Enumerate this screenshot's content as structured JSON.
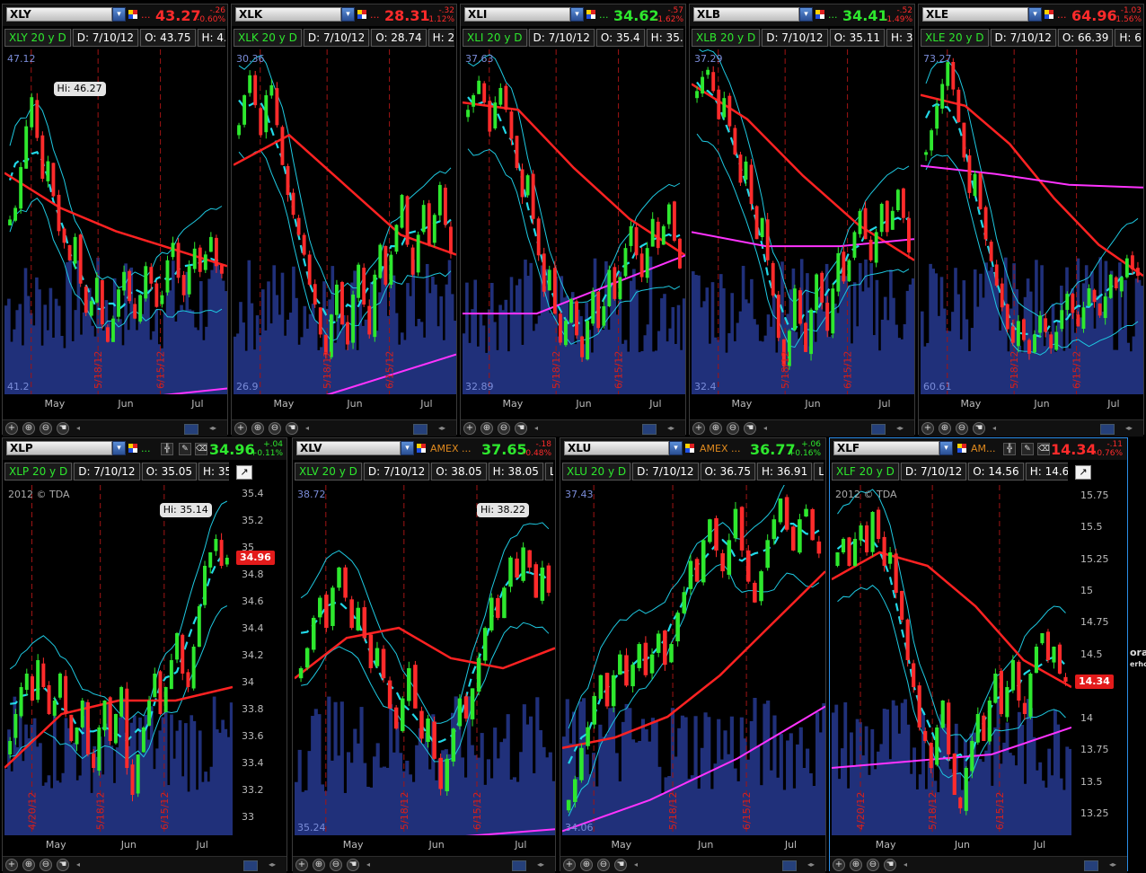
{
  "app": {
    "side_text": [
      "ora",
      "erhc"
    ]
  },
  "colors": {
    "up": "#2ee82e",
    "down": "#ff2b2b",
    "ma50": "#ff2222",
    "ma20": "#22d8e8",
    "ma200": "#ff33ff",
    "bands": "#1ec8e0",
    "volume": "#20307a"
  },
  "icons": {
    "header": [
      "dropdown-icon",
      "link-flag-icon",
      "crosshair-icon",
      "pencil-icon",
      "eraser-icon"
    ],
    "footer": [
      "crosshair-icon",
      "zoom-in-icon",
      "zoom-out-icon",
      "drag-hand-icon",
      "scroll-left-icon",
      "scroll-right-icon",
      "expand-icon"
    ]
  },
  "panes": [
    {
      "symbol": "XLY",
      "exchange": "...",
      "last": "43.27",
      "change": "-.26",
      "change_pct": "-0.60%",
      "dir": "dn",
      "study_label": "XLY 20 y D",
      "date_label": "D: 7/10/12",
      "open_label": "O: 43.75",
      "extra_label": "H: 4...",
      "axis_top": "47.12",
      "axis_bottom": "41.2",
      "hi_label": "Hi: 46.27",
      "months": [
        "May",
        "Jun",
        "Jul"
      ],
      "date_marks": [
        "5/18/12",
        "6/15/12"
      ],
      "chart_data": {
        "type": "candlestick",
        "closes": [
          44.2,
          44.4,
          45.1,
          45.8,
          46.3,
          45.6,
          44.9,
          45.2,
          44.6,
          44.0,
          43.8,
          43.5,
          43.9,
          43.1,
          42.6,
          42.8,
          43.2,
          42.4,
          42.1,
          42.5,
          43.0,
          43.3,
          42.8,
          42.5,
          42.9,
          43.4,
          43.1,
          42.7,
          42.9,
          43.5,
          43.8,
          43.2,
          42.9,
          43.4,
          43.7,
          43.3,
          43.6,
          43.9,
          43.4,
          43.27
        ],
        "ylim": [
          41.2,
          47.12
        ],
        "ma50": [
          45.0,
          44.4,
          44.0,
          43.7,
          43.4
        ],
        "ma200": [
          40.9,
          41.3
        ]
      }
    },
    {
      "symbol": "XLK",
      "exchange": "...",
      "last": "28.31",
      "change": "-.32",
      "change_pct": "-1.12%",
      "dir": "dn",
      "study_label": "XLK 20 y D",
      "date_label": "D: 7/10/12",
      "open_label": "O: 28.74",
      "extra_label": "H: 2...",
      "axis_top": "30.36",
      "axis_bottom": "26.9",
      "months": [
        "May",
        "Jun",
        "Jul"
      ],
      "date_marks": [
        "5/18/12",
        "6/15/12"
      ],
      "chart_data": {
        "type": "candlestick",
        "closes": [
          29.6,
          29.9,
          30.1,
          29.8,
          29.5,
          29.9,
          30.0,
          29.6,
          29.2,
          28.9,
          28.7,
          28.5,
          28.3,
          28.0,
          27.8,
          27.5,
          27.3,
          27.7,
          28.0,
          27.6,
          27.4,
          27.9,
          28.2,
          27.8,
          27.5,
          28.1,
          28.4,
          28.0,
          28.3,
          28.6,
          28.9,
          28.4,
          28.1,
          28.5,
          28.8,
          28.4,
          28.7,
          29.0,
          28.6,
          28.31
        ],
        "ylim": [
          26.9,
          30.36
        ],
        "ma50": [
          29.2,
          29.5,
          29.0,
          28.5,
          28.3
        ],
        "ma200": [
          26.6,
          27.3
        ]
      }
    },
    {
      "symbol": "XLI",
      "exchange": "...",
      "last": "34.62",
      "change": "-.57",
      "change_pct": "-1.62%",
      "dir": "up",
      "study_label": "XLI 20 y D",
      "date_label": "D: 7/10/12",
      "open_label": "O: 35.4",
      "extra_label": "H: 35...",
      "axis_top": "37.63",
      "axis_bottom": "32.89",
      "months": [
        "May",
        "Jun",
        "Jul"
      ],
      "date_marks": [
        "5/18/12",
        "6/15/12"
      ],
      "chart_data": {
        "type": "candlestick",
        "closes": [
          36.8,
          37.0,
          37.2,
          36.9,
          36.5,
          36.9,
          37.1,
          36.8,
          36.4,
          36.0,
          35.6,
          35.9,
          35.3,
          34.8,
          34.3,
          34.6,
          34.0,
          33.6,
          33.9,
          34.2,
          33.7,
          33.4,
          33.9,
          34.3,
          33.8,
          34.1,
          34.6,
          34.2,
          34.5,
          34.9,
          35.2,
          34.8,
          34.5,
          34.9,
          35.3,
          34.9,
          35.2,
          35.5,
          35.0,
          34.62
        ],
        "ylim": [
          32.89,
          37.63
        ],
        "ma50": [
          36.9,
          36.8,
          36.0,
          35.3,
          34.8
        ],
        "ma200": [
          34.0,
          34.0,
          34.4,
          34.8
        ]
      }
    },
    {
      "symbol": "XLB",
      "exchange": "...",
      "last": "34.41",
      "change": "-.52",
      "change_pct": "-1.49%",
      "dir": "up",
      "study_label": "XLB 20 y D",
      "date_label": "D: 7/10/12",
      "open_label": "O: 35.11",
      "extra_label": "H: 35...",
      "axis_top": "37.29",
      "axis_bottom": "32.4",
      "months": [
        "May",
        "Jun",
        "Jul"
      ],
      "date_marks": [
        "5/18/12",
        "6/15/12"
      ],
      "chart_data": {
        "type": "candlestick",
        "closes": [
          36.7,
          36.9,
          37.0,
          36.7,
          36.3,
          36.6,
          36.2,
          35.8,
          35.4,
          35.7,
          35.1,
          34.6,
          34.9,
          34.3,
          33.8,
          33.2,
          32.8,
          33.3,
          33.9,
          33.4,
          33.0,
          33.6,
          34.1,
          33.7,
          33.3,
          33.9,
          34.4,
          34.0,
          34.3,
          34.7,
          35.0,
          34.6,
          34.3,
          34.7,
          35.1,
          34.7,
          35.0,
          35.3,
          34.9,
          34.41
        ],
        "ylim": [
          32.4,
          37.29
        ],
        "ma50": [
          36.8,
          36.3,
          35.5,
          34.8,
          34.3
        ],
        "ma200": [
          34.7,
          34.5,
          34.5,
          34.6
        ]
      }
    },
    {
      "symbol": "XLE",
      "exchange": "...",
      "last": "64.96",
      "change": "-1.03",
      "change_pct": "-1.56%",
      "dir": "dn",
      "study_label": "XLE 20 y D",
      "date_label": "D: 7/10/12",
      "open_label": "O: 66.39",
      "extra_label": "H: 6...",
      "axis_top": "73.27",
      "axis_bottom": "60.61",
      "months": [
        "May",
        "Jun",
        "Jul"
      ],
      "date_marks": [
        "5/18/12",
        "6/15/12"
      ],
      "chart_data": {
        "type": "candlestick",
        "closes": [
          69.5,
          70.3,
          71.2,
          72.0,
          72.8,
          71.8,
          70.6,
          69.3,
          68.0,
          68.7,
          67.4,
          66.3,
          65.5,
          64.6,
          63.8,
          63.0,
          62.5,
          63.3,
          62.6,
          62.1,
          62.8,
          63.5,
          62.9,
          62.3,
          62.9,
          63.7,
          64.3,
          63.6,
          63.1,
          63.8,
          64.5,
          64.0,
          63.5,
          64.2,
          65.0,
          64.5,
          64.9,
          65.6,
          65.2,
          64.96
        ],
        "ylim": [
          60.61,
          73.27
        ],
        "ma50": [
          71.6,
          71.2,
          69.8,
          67.8,
          66.1,
          64.96
        ],
        "ma200": [
          69.0,
          68.7,
          68.3,
          68.2
        ]
      }
    },
    {
      "symbol": "XLP",
      "exchange": "...",
      "last": "34.96",
      "change": "+.04",
      "change_pct": "+0.11%",
      "dir": "up",
      "study_label": "XLP 20 y D",
      "date_label": "D: 7/10/12",
      "open_label": "O: 35.05",
      "extra_label": "H: 35...",
      "copyright": "2012 © TDA",
      "hi_label": "Hi: 35.14",
      "price_tag": "34.96",
      "y_ticks": [
        "35.4",
        "35.2",
        "35",
        "34.8",
        "34.6",
        "34.4",
        "34.2",
        "34",
        "33.8",
        "33.6",
        "33.4",
        "33.2",
        "33"
      ],
      "months": [
        "May",
        "Jun",
        "Jul"
      ],
      "date_marks": [
        "4/20/12",
        "5/18/12",
        "6/15/12"
      ],
      "chart_data": {
        "type": "candlestick",
        "closes": [
          33.6,
          33.8,
          34.0,
          34.1,
          33.9,
          34.2,
          34.0,
          33.8,
          33.9,
          34.1,
          33.8,
          33.6,
          33.7,
          33.9,
          33.5,
          33.4,
          33.7,
          33.9,
          33.6,
          33.8,
          34.0,
          33.4,
          33.2,
          33.5,
          33.7,
          33.9,
          34.1,
          33.8,
          34.0,
          34.2,
          34.4,
          34.1,
          34.0,
          34.3,
          34.6,
          34.9,
          35.0,
          35.1,
          34.9,
          34.96
        ],
        "ylim": [
          32.9,
          35.5
        ],
        "ma50": [
          33.4,
          33.8,
          33.9,
          33.9,
          34.0
        ]
      }
    },
    {
      "symbol": "XLV",
      "exchange": "AMEX ...",
      "last": "37.65",
      "change": "-.18",
      "change_pct": "-0.48%",
      "dir": "up",
      "study_label": "XLV 20 y D",
      "date_label": "D: 7/10/12",
      "open_label": "O: 38.05",
      "extra_label": "H: 38.05",
      "extra2_label": "L:...",
      "axis_top": "38.72",
      "axis_bottom": "35.24",
      "hi_label": "Hi: 38.22",
      "months": [
        "May",
        "Jun",
        "Jul"
      ],
      "date_marks": [
        "5/18/12",
        "6/15/12"
      ],
      "chart_data": {
        "type": "candlestick",
        "closes": [
          36.9,
          37.1,
          37.4,
          37.6,
          37.3,
          37.7,
          37.9,
          37.6,
          37.3,
          37.5,
          37.2,
          36.9,
          37.1,
          36.8,
          36.5,
          36.3,
          36.6,
          36.9,
          36.5,
          36.2,
          36.4,
          36.0,
          35.7,
          36.0,
          36.3,
          36.6,
          36.4,
          36.7,
          37.0,
          37.3,
          37.6,
          37.4,
          37.7,
          38.0,
          37.8,
          38.1,
          37.9,
          37.6,
          37.9,
          37.65
        ],
        "ylim": [
          35.24,
          38.72
        ],
        "ma50": [
          36.8,
          37.2,
          37.3,
          37.0,
          36.9,
          37.1
        ],
        "ma200": [
          35.1,
          35.3
        ]
      }
    },
    {
      "symbol": "XLU",
      "exchange": "AMEX ...",
      "last": "36.77",
      "change": "+.06",
      "change_pct": "+0.16%",
      "dir": "up",
      "study_label": "XLU 20 y D",
      "date_label": "D: 7/10/12",
      "open_label": "O: 36.75",
      "extra_label": "H: 36.91",
      "extra2_label": "L:...",
      "axis_top": "37.43",
      "axis_bottom": "34.06",
      "months": [
        "May",
        "Jun",
        "Jul"
      ],
      "date_marks": [
        "5/18/12",
        "6/15/12"
      ],
      "chart_data": {
        "type": "candlestick",
        "closes": [
          34.4,
          34.6,
          34.9,
          35.1,
          35.4,
          35.6,
          35.3,
          35.6,
          35.8,
          35.5,
          35.7,
          35.9,
          35.6,
          35.8,
          36.0,
          35.7,
          35.9,
          36.2,
          36.4,
          36.7,
          36.5,
          36.9,
          37.1,
          36.8,
          36.6,
          36.9,
          37.2,
          36.8,
          36.5,
          36.3,
          36.6,
          36.9,
          37.1,
          37.3,
          37.0,
          36.8,
          37.1,
          37.2,
          36.9,
          36.77
        ],
        "ylim": [
          34.06,
          37.43
        ],
        "ma50": [
          34.9,
          35.0,
          35.2,
          35.6,
          36.1,
          36.6
        ],
        "ma200": [
          34.1,
          34.4,
          34.8,
          35.3
        ]
      }
    },
    {
      "symbol": "XLF",
      "exchange": "AM...",
      "last": "14.34",
      "change": "-.11",
      "change_pct": "-0.76%",
      "dir": "dn",
      "study_label": "XLF 20 y D",
      "date_label": "D: 7/10/12",
      "open_label": "O: 14.56",
      "extra_label": "H: 14.6",
      "copyright": "2012 © TDA",
      "price_tag": "14.34",
      "y_ticks": [
        "15.75",
        "15.5",
        "15.25",
        "15",
        "14.75",
        "14.5",
        "14.25",
        "14",
        "13.75",
        "13.5",
        "13.25"
      ],
      "months": [
        "May",
        "Jun",
        "Jul"
      ],
      "date_marks": [
        "4/20/12",
        "5/18/12",
        "6/15/12"
      ],
      "chart_data": {
        "type": "candlestick",
        "closes": [
          15.3,
          15.4,
          15.2,
          15.4,
          15.5,
          15.3,
          15.6,
          15.4,
          15.2,
          15.3,
          15.0,
          14.8,
          14.5,
          14.3,
          14.0,
          13.9,
          13.7,
          14.0,
          14.2,
          13.8,
          13.5,
          13.4,
          13.7,
          13.9,
          14.1,
          13.9,
          14.2,
          14.4,
          14.1,
          14.3,
          14.5,
          14.2,
          14.1,
          14.4,
          14.6,
          14.7,
          14.5,
          14.6,
          14.4,
          14.34
        ],
        "ylim": [
          13.2,
          15.8
        ],
        "ma50": [
          15.1,
          15.3,
          15.2,
          14.9,
          14.5,
          14.3
        ],
        "ma200": [
          13.7,
          13.75,
          13.8,
          14.0
        ]
      }
    }
  ]
}
